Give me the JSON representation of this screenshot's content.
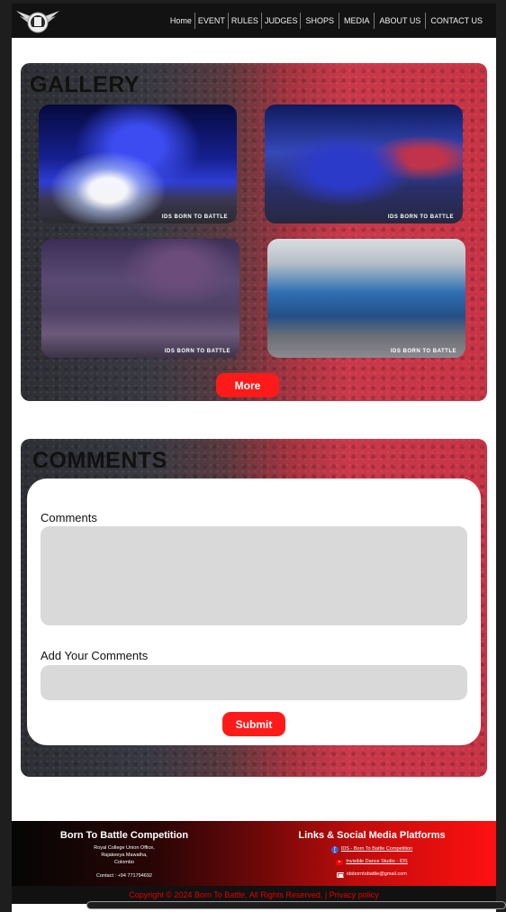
{
  "nav": {
    "items": [
      "Home",
      "EVENT",
      "RULES",
      "JUDGES",
      "SHOPS",
      "MEDIA",
      "ABOUT US",
      "CONTACT US"
    ]
  },
  "gallery": {
    "title": "GALLERY",
    "watermark": "IDS BORN TO BATTLE",
    "more_label": "More"
  },
  "comments": {
    "title": "COMMENTS",
    "comments_label": "Comments",
    "add_label": "Add Your Comments",
    "submit_label": "Submit"
  },
  "footer": {
    "left_title": "Born To Battle Competition",
    "address_lines": [
      "Royal College Union Office,",
      "Rajakeeya Mawatha,",
      "Colombo"
    ],
    "contact": "Contact : +94 771794692",
    "right_title": "Links & Social Media Platforms",
    "links": [
      {
        "text": "IDS - Born To Battle Competition",
        "icon": "facebook-icon"
      },
      {
        "text": "Invisible Dance Studio - IDS",
        "icon": "youtube-icon"
      },
      {
        "text": "idsborntobattle@gmail.com",
        "icon": "gmail-icon"
      }
    ]
  },
  "copyright": {
    "text": "Copyright © 2024 Born To Battle. All Rights Reserved.",
    "separator": "|",
    "privacy": "Privacy policy"
  },
  "colors": {
    "accent": "#ff1a1a",
    "panel_red": "#c9394a",
    "panel_dark": "#2e2e35",
    "navbar": "#121212"
  }
}
